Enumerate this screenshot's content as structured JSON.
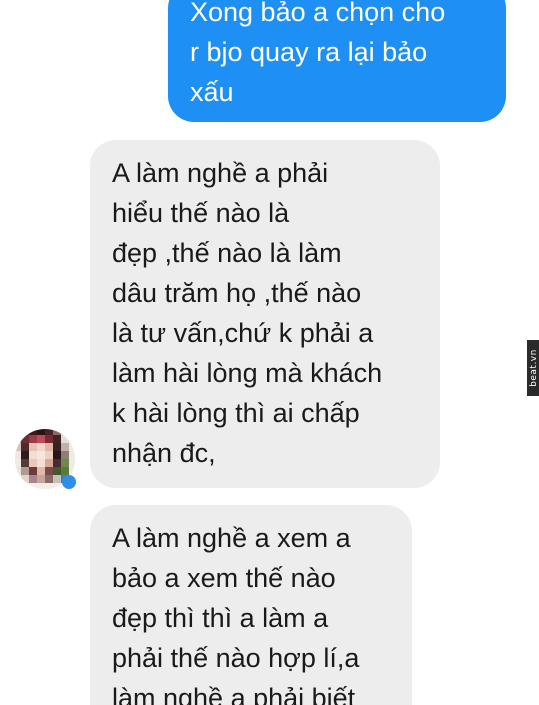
{
  "conversation": {
    "messages": [
      {
        "sender": "me",
        "text": "Xong bảo a chọn cho\nr bjo quay ra lại bảo\nxấu"
      },
      {
        "sender": "other",
        "text": "A làm nghề a phải\nhiểu thế nào là\nđẹp ,thế nào là làm\ndâu trăm họ ,thế nào\nlà tư vấn,chứ k phải a\nlàm hài lòng mà khách\nk hài lòng thì ai chấp\nnhận đc,"
      },
      {
        "sender": "other",
        "text": "A làm nghề a xem a\nbảo a xem thế nào\nđẹp thì thì a làm a\nphải thế nào hợp lí,a\nlàm nghề a phải biết"
      }
    ]
  },
  "watermark": {
    "text": "beat.vn"
  },
  "colors": {
    "outgoing_bubble": "#1e90f5",
    "incoming_bubble": "#ededed",
    "incoming_text": "#1a1a1a"
  },
  "icons": {
    "avatar": "blurred-profile-avatar"
  }
}
